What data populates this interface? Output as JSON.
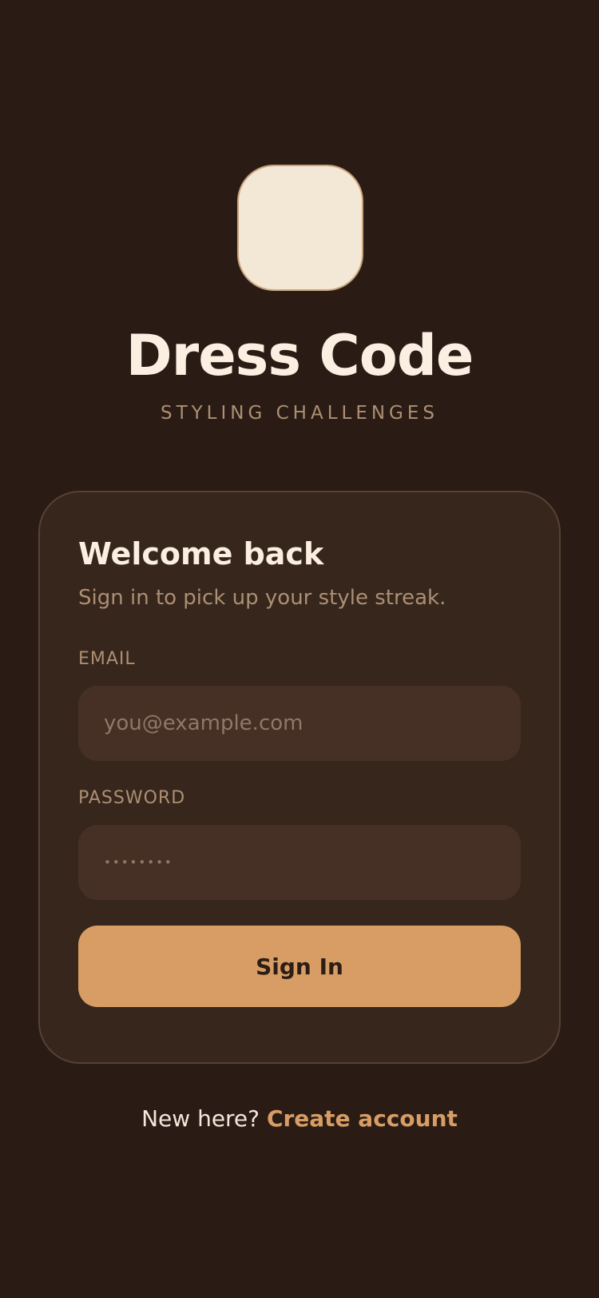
{
  "app": {
    "title": "Dress Code",
    "subtitle": "STYLING CHALLENGES",
    "logo_icon": "app-logo-icon"
  },
  "card": {
    "title": "Welcome back",
    "subtitle": "Sign in to pick up your style streak.",
    "email": {
      "label": "EMAIL",
      "placeholder": "you@example.com",
      "value": ""
    },
    "password": {
      "label": "PASSWORD",
      "placeholder": "••••••••",
      "value": ""
    },
    "submit_label": "Sign In"
  },
  "footer": {
    "prompt": "New here?",
    "link_label": "Create account"
  },
  "colors": {
    "background": "#2a1c15",
    "card": "#36261c",
    "input": "#463026",
    "accent": "#d89d64",
    "title": "#fbefe2",
    "muted": "#ad8f74"
  }
}
